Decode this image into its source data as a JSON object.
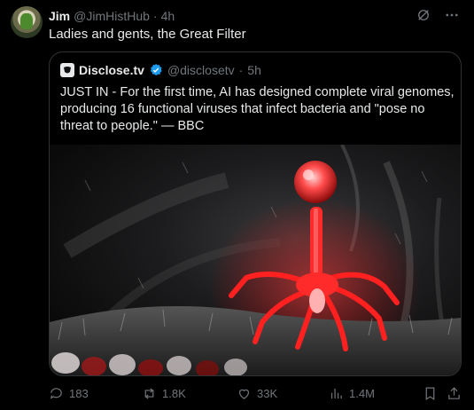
{
  "tweet": {
    "author_name": "Jim",
    "author_handle": "@JimHistHub",
    "separator": "·",
    "time": "4h",
    "text": "Ladies and gents, the Great Filter"
  },
  "quote": {
    "author_name": "Disclose.tv",
    "author_handle": "@disclosetv",
    "separator": "·",
    "time": "5h",
    "text": "JUST IN - For the first time, AI has designed complete viral genomes, producing 16 functional viruses that infect bacteria and \"pose no threat to people.\" — BBC"
  },
  "metrics": {
    "replies": "183",
    "reposts": "1.8K",
    "likes": "33K",
    "views": "1.4M"
  },
  "icons": {
    "grok": "grok-icon",
    "more": "more-icon",
    "verified": "verified-badge-icon",
    "reply": "reply-icon",
    "repost": "repost-icon",
    "like": "like-icon",
    "views": "views-icon",
    "bookmark": "bookmark-icon",
    "share": "share-icon"
  },
  "colors": {
    "background": "#000000",
    "text": "#e7e9ea",
    "muted": "#71767b",
    "border": "#2f3336",
    "verified": "#1d9bf0",
    "virus_red": "#ff2a2a"
  }
}
